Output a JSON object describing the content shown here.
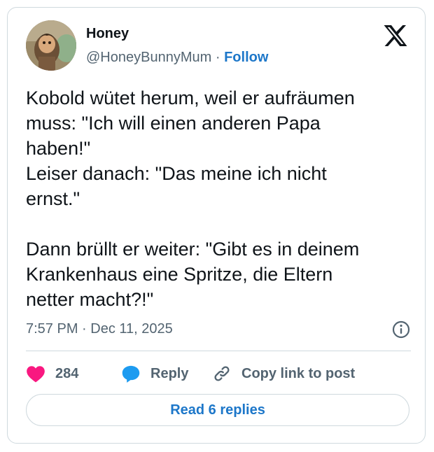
{
  "author": {
    "name": "Honey",
    "handle": "@HoneyBunnyMum",
    "separator": "·",
    "follow_label": "Follow",
    "avatar_icon": "avatar-photo"
  },
  "platform": {
    "logo_icon": "x-logo-icon"
  },
  "tweet": {
    "text": "Kobold wütet herum, weil er aufräumen\nmuss: \"Ich will einen anderen Papa\nhaben!\"\nLeiser danach: \"Das meine ich nicht\nernst.\"\n\nDann brüllt er weiter: \"Gibt es in deinem\nKrankenhaus eine Spritze, die Eltern\nnetter macht?!\"",
    "timestamp": "7:57 PM · Dec 11, 2025"
  },
  "actions": {
    "like_count": "284",
    "reply_label": "Reply",
    "copy_link_label": "Copy link to post"
  },
  "read_replies_label": "Read 6 replies",
  "colors": {
    "accent": "#1d77c9",
    "like": "#f91880",
    "text": "#0f1419",
    "muted": "#536471",
    "border": "#cfd9de"
  }
}
